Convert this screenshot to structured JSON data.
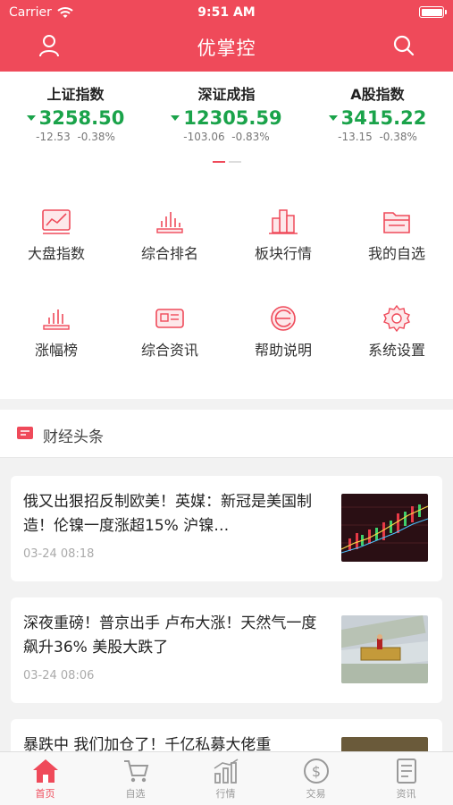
{
  "status_bar": {
    "carrier": "Carrier",
    "time": "9:51 AM"
  },
  "navbar": {
    "title": "优掌控"
  },
  "indices": [
    {
      "name": "上证指数",
      "value": "3258.50",
      "change": "-12.53",
      "percent": "-0.38%"
    },
    {
      "name": "深证成指",
      "value": "12305.59",
      "change": "-103.06",
      "percent": "-0.83%"
    },
    {
      "name": "A股指数",
      "value": "3415.22",
      "change": "-13.15",
      "percent": "-0.38%"
    }
  ],
  "menu": [
    {
      "label": "大盘指数",
      "icon": "market-index-icon"
    },
    {
      "label": "综合排名",
      "icon": "ranking-icon"
    },
    {
      "label": "板块行情",
      "icon": "sector-icon"
    },
    {
      "label": "我的自选",
      "icon": "watchlist-icon"
    },
    {
      "label": "涨幅榜",
      "icon": "gainers-icon"
    },
    {
      "label": "综合资讯",
      "icon": "news-icon"
    },
    {
      "label": "帮助说明",
      "icon": "help-icon"
    },
    {
      "label": "系统设置",
      "icon": "settings-icon"
    }
  ],
  "news_section": {
    "title": "财经头条"
  },
  "news": [
    {
      "title": "俄又出狠招反制欧美！英媒：新冠是美国制造！伦镍一度涨超15% 沪镍…",
      "date": "03-24 08:18"
    },
    {
      "title": "深夜重磅！普京出手 卢布大涨！天然气一度飙升36% 美股大跌了",
      "date": "03-24 08:06"
    },
    {
      "title": "暴跌中 我们加仓了！千亿私募大佬重",
      "date": ""
    }
  ],
  "tabs": [
    {
      "label": "首页",
      "icon": "home-icon",
      "active": true
    },
    {
      "label": "自选",
      "icon": "cart-icon",
      "active": false
    },
    {
      "label": "行情",
      "icon": "chart-icon",
      "active": false
    },
    {
      "label": "交易",
      "icon": "dollar-icon",
      "active": false
    },
    {
      "label": "资讯",
      "icon": "document-icon",
      "active": false
    }
  ],
  "colors": {
    "brand": "#ef4a5a",
    "down": "#1aa34a",
    "muted": "#aaaaaa"
  }
}
